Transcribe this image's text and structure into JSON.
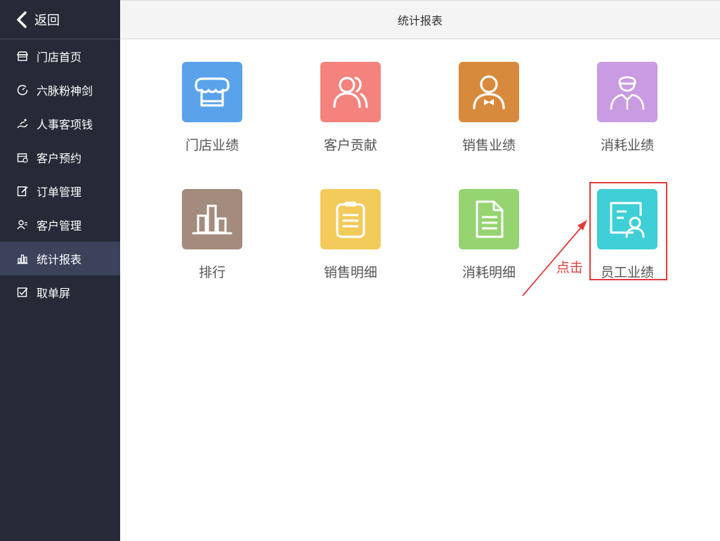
{
  "sidebar": {
    "back_label": "返回",
    "items": [
      {
        "label": "门店首页",
        "icon": "store-icon"
      },
      {
        "label": "六脉粉神剑",
        "icon": "gauge-icon"
      },
      {
        "label": "人事客项钱",
        "icon": "flow-icon"
      },
      {
        "label": "客户预约",
        "icon": "calendar-icon"
      },
      {
        "label": "订单管理",
        "icon": "edit-doc-icon"
      },
      {
        "label": "客户管理",
        "icon": "users-icon"
      },
      {
        "label": "统计报表",
        "icon": "bar-chart-icon",
        "active": true
      },
      {
        "label": "取单屏",
        "icon": "checkbox-icon"
      }
    ]
  },
  "header": {
    "title": "统计报表"
  },
  "tiles": [
    {
      "label": "门店业绩",
      "icon": "store-awning-icon",
      "color": "#5aa3ea"
    },
    {
      "label": "客户贡献",
      "icon": "customers-icon",
      "color": "#f3837c"
    },
    {
      "label": "销售业绩",
      "icon": "salesperson-icon",
      "color": "#d88a3c"
    },
    {
      "label": "消耗业绩",
      "icon": "worker-icon",
      "color": "#c99be2"
    },
    {
      "label": "排行",
      "icon": "ranking-icon",
      "color": "#a38c7e"
    },
    {
      "label": "销售明细",
      "icon": "clipboard-icon",
      "color": "#f3cb5b"
    },
    {
      "label": "消耗明细",
      "icon": "document-icon",
      "color": "#95d470"
    },
    {
      "label": "员工业绩",
      "icon": "staff-card-icon",
      "color": "#3fcfd6"
    }
  ],
  "annotation": {
    "text": "点击",
    "color": "#e23b3b"
  }
}
